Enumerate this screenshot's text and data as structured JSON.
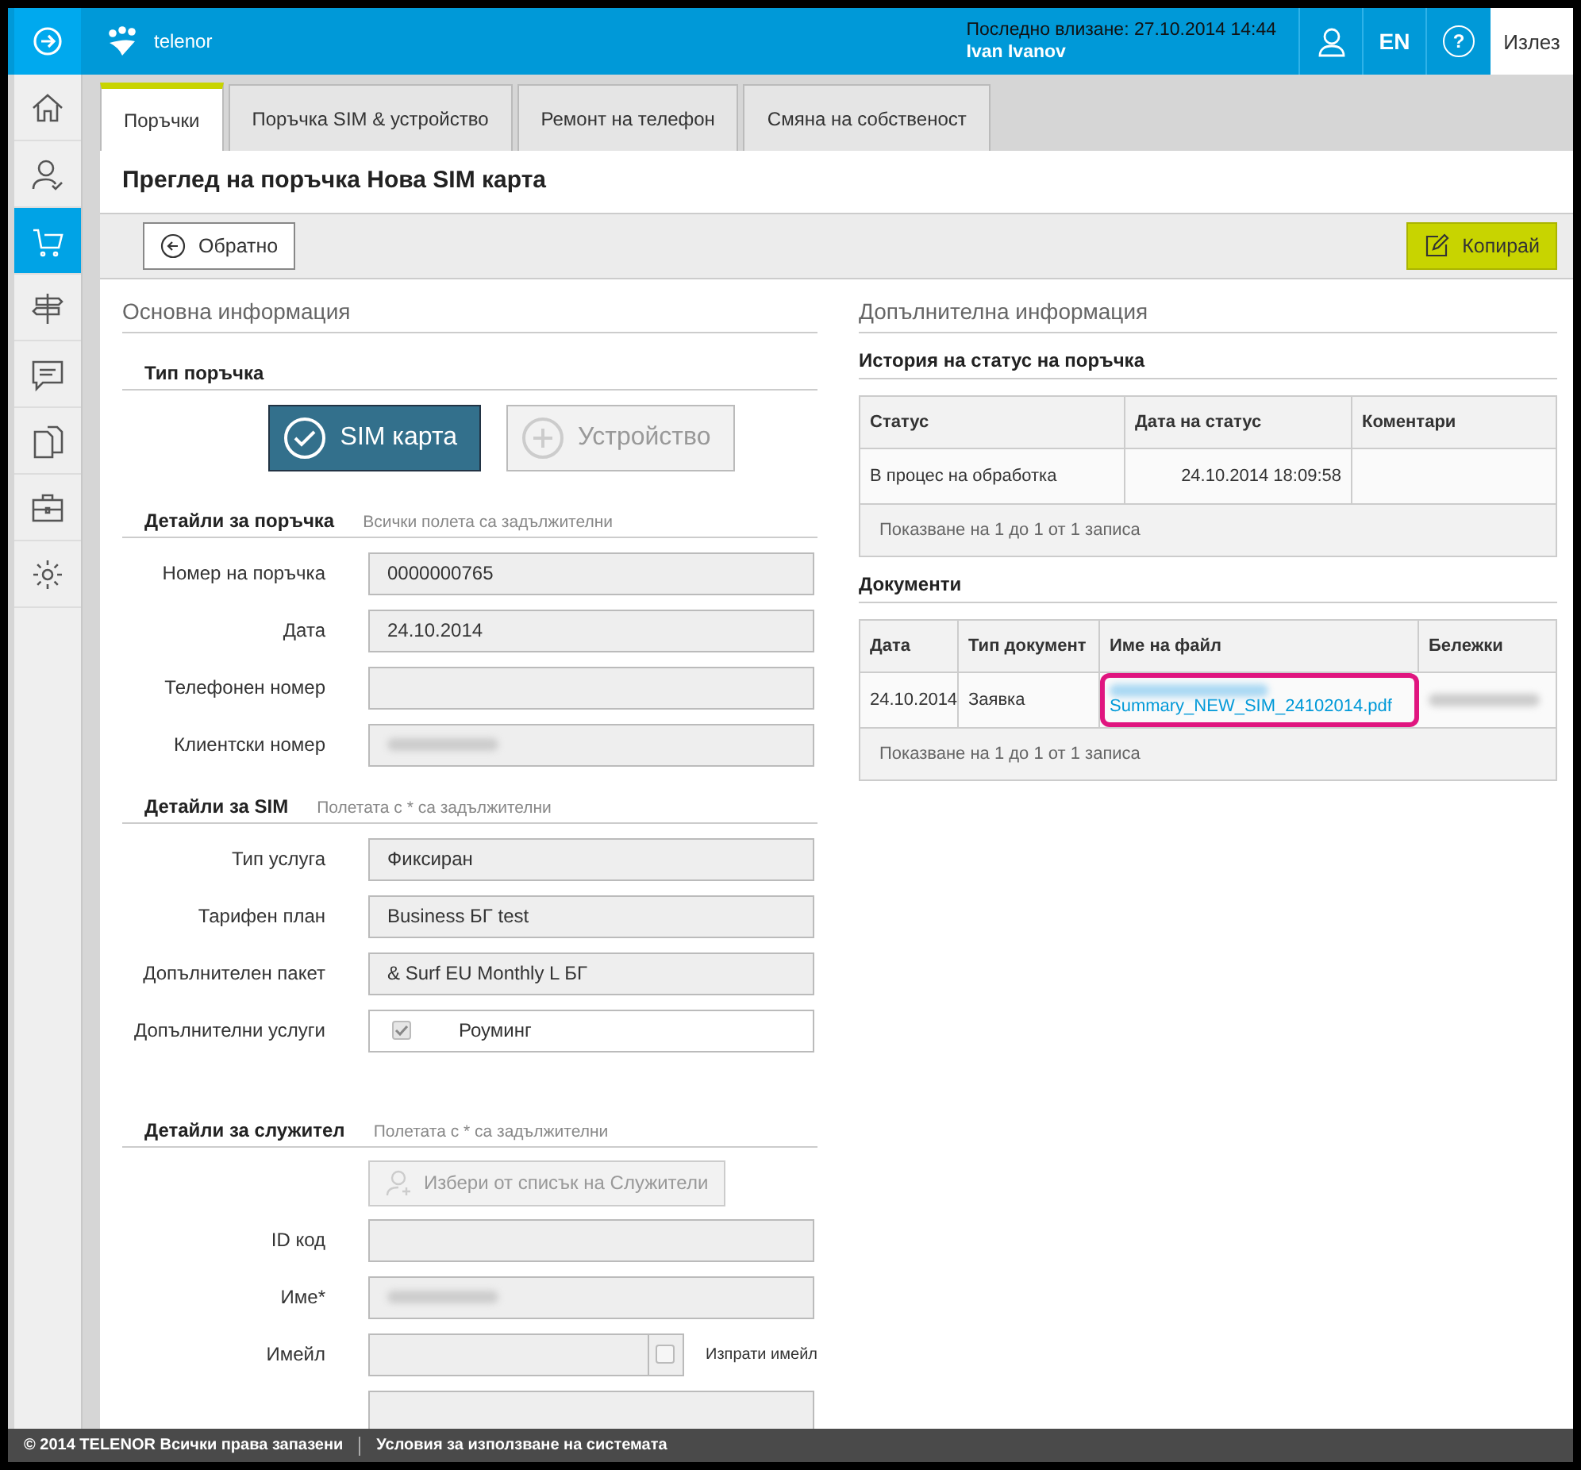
{
  "header": {
    "brand": "telenor",
    "help": "?",
    "last_login": "Последно влизане: 27.10.2014 14:44",
    "user": "Ivan Ivanov",
    "language": "EN",
    "logout": "Излез"
  },
  "sidebar": {
    "items": [
      {
        "selected": false
      },
      {
        "selected": false
      },
      {
        "selected": true
      },
      {
        "selected": false
      },
      {
        "selected": false
      },
      {
        "selected": false
      },
      {
        "selected": false
      },
      {
        "selected": false
      }
    ]
  },
  "tabs": [
    {
      "label": "Поръчки",
      "selected": true
    },
    {
      "label": "Поръчка SIM & устройство",
      "selected": false
    },
    {
      "label": "Ремонт на телефон",
      "selected": false
    },
    {
      "label": "Смяна на собственост",
      "selected": false
    }
  ],
  "page_title": "Преглед на поръчка Нова SIM карта",
  "toolbar": {
    "back": "Обратно",
    "copy": "Копирай"
  },
  "main_info": {
    "title": "Основна информация",
    "order_type": {
      "title": "Тип поръчка",
      "options": [
        {
          "label": "SIM карта",
          "selected": true
        },
        {
          "label": "Устройство",
          "selected": false
        }
      ]
    },
    "sections": [
      {
        "title": "Детайли за поръчка",
        "note": "Всички полета са задължителни",
        "fields": [
          {
            "kind": "text",
            "label": "Номер на поръчка",
            "value": "0000000765"
          },
          {
            "kind": "text",
            "label": "Дата",
            "value": "24.10.2014"
          },
          {
            "kind": "text",
            "label": "Телефонен номер"
          },
          {
            "kind": "text",
            "label": "Клиентски номер",
            "blurred": true
          }
        ]
      },
      {
        "title": "Детайли за SIM",
        "note": "Полетата с * са задължителни",
        "fields": [
          {
            "kind": "text",
            "label": "Тип услуга",
            "value": "Фиксиран"
          },
          {
            "kind": "text",
            "label": "Тарифен план",
            "value": "Business БГ test"
          },
          {
            "kind": "text",
            "label": "Допълнителен пакет",
            "value": "& Surf EU Monthly L БГ"
          },
          {
            "kind": "checkbox",
            "label": "Допълнителни услуги",
            "value": "Роуминг",
            "checked": true
          }
        ]
      },
      {
        "title": "Детайли за служител",
        "note": "Полетата с * са задължителни",
        "button": "Избери от списък на Служители",
        "fields": [
          {
            "kind": "text",
            "label": "ID код"
          },
          {
            "kind": "text",
            "label": "Име*",
            "blurred": true
          },
          {
            "kind": "email",
            "label": "Имейл",
            "send_label": "Изпрати имейл",
            "checked": false
          },
          {
            "kind": "text"
          }
        ]
      }
    ]
  },
  "extra_info": {
    "title": "Допълнителна информация",
    "status_history": {
      "title": "История на статус на поръчка",
      "columns": [
        "Статус",
        "Дата на статус",
        "Коментари"
      ],
      "rows": [
        [
          "В процес на обработка",
          "24.10.2014 18:09:58",
          ""
        ]
      ],
      "footer": "Показване на 1 до 1 от 1 записа"
    },
    "documents": {
      "title": "Документи",
      "columns": [
        "Дата",
        "Тип документ",
        "Име на файл",
        "Бележки"
      ],
      "rows": [
        {
          "date": "24.10.2014",
          "type": "Заявка",
          "file": "Summary_NEW_SIM_24102014.pdf",
          "highlighted": true
        }
      ],
      "footer": "Показване на 1 до 1 от 1 записа"
    }
  },
  "footer": {
    "copyright": "© 2014 TELENOR Всички права запазени",
    "terms": "Условия за използване на системата"
  }
}
